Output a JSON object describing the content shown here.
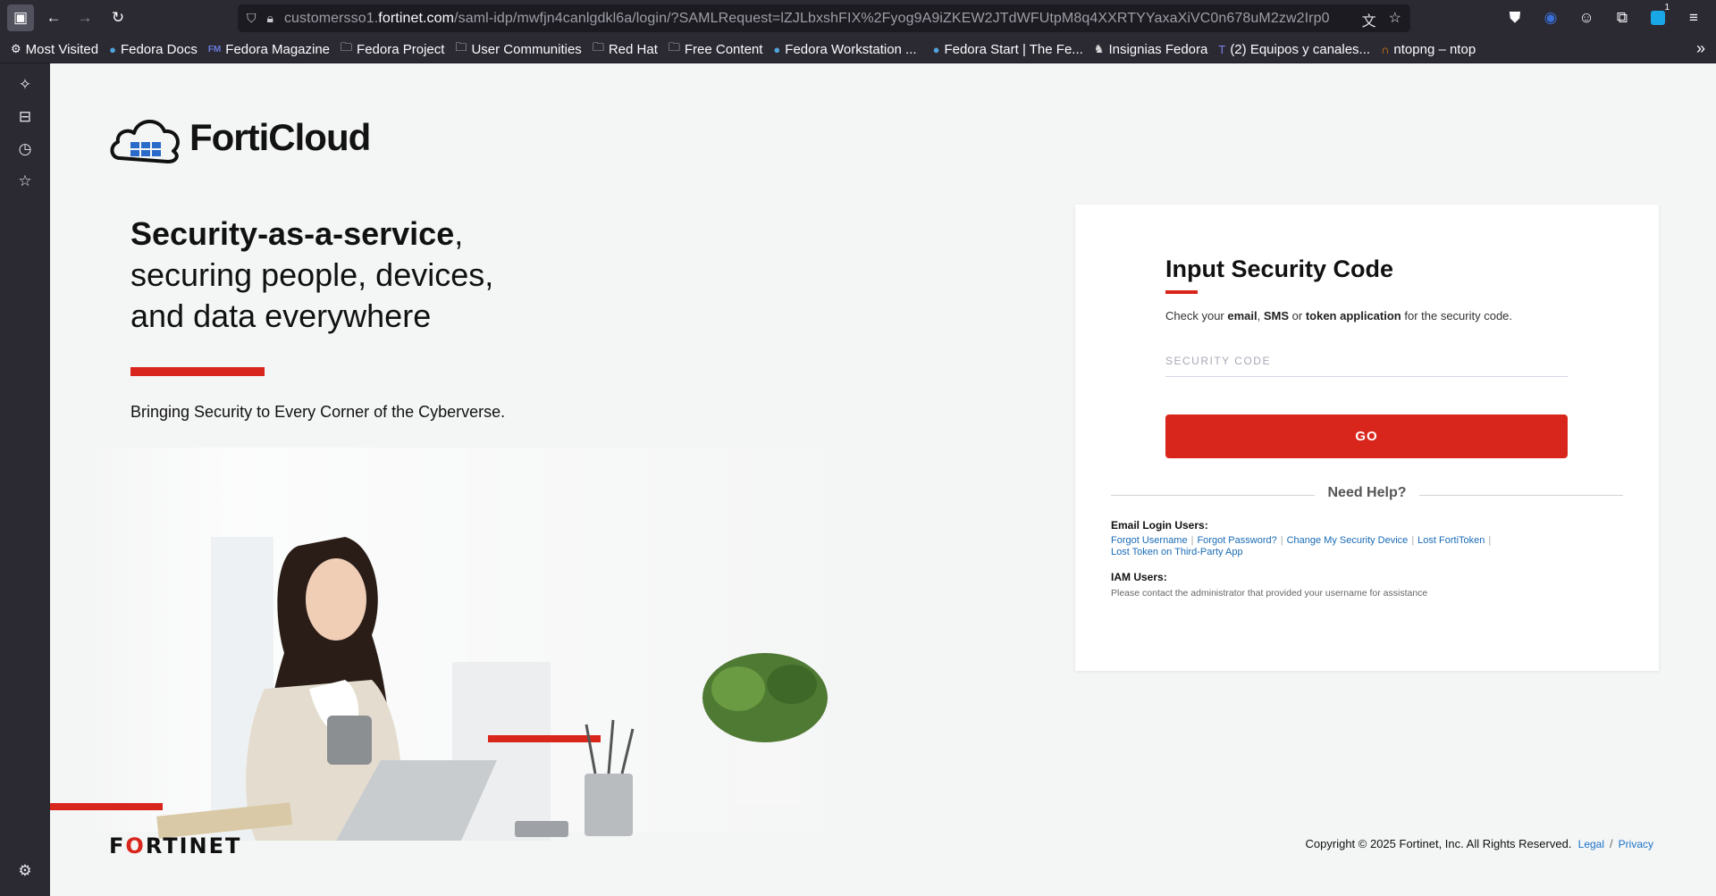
{
  "browser": {
    "url_host_prefix": "customersso1.",
    "url_host": "fortinet.com",
    "url_path": "/saml-idp/mwfjn4canlgdkl6a/login/?SAMLRequest=lZJLbxshFIX%2Fyog9A9iZKEW2JTdWFUtpM8q4XXRTYYaxaXiVC0n678uM2zw2Irp0"
  },
  "bookmarks": [
    {
      "label": "Most Visited",
      "icon": "gear"
    },
    {
      "label": "Fedora Docs",
      "icon": "fedora"
    },
    {
      "label": "Fedora Magazine",
      "icon": "fm"
    },
    {
      "label": "Fedora Project",
      "icon": "folder"
    },
    {
      "label": "User Communities",
      "icon": "folder"
    },
    {
      "label": "Red Hat",
      "icon": "folder"
    },
    {
      "label": "Free Content",
      "icon": "folder"
    },
    {
      "label": "Fedora Workstation ...",
      "icon": "fedora"
    },
    {
      "label": "Fedora Start | The Fe...",
      "icon": "fedora"
    },
    {
      "label": "Insignias Fedora",
      "icon": "badge"
    },
    {
      "label": "(2) Equipos y canales...",
      "icon": "teams"
    },
    {
      "label": "ntopng – ntop",
      "icon": "ntop"
    }
  ],
  "extension_badge_count": "1",
  "page": {
    "logo_text": "FortiCloud",
    "headline_bold": "Security-as-a-service",
    "headline_rest_1": ",",
    "headline_line2": "securing people, devices,",
    "headline_line3": "and data everywhere",
    "tagline": "Bringing Security to Every Corner of the Cyberverse.",
    "footer_brand": "FORTINET",
    "copyright": "Copyright © 2025 Fortinet, Inc.  All Rights Reserved.",
    "legal_link": "Legal",
    "privacy_link": "Privacy",
    "link_separator": "/"
  },
  "card": {
    "title": "Input Security Code",
    "desc_1": "Check your ",
    "desc_email": "email",
    "desc_2": ", ",
    "desc_sms": "SMS",
    "desc_3": " or ",
    "desc_token": "token application",
    "desc_4": " for the security code.",
    "code_placeholder": "SECURITY CODE",
    "code_value": "",
    "go_label": "GO",
    "help_label": "Need Help?",
    "email_users_heading": "Email Login Users:",
    "links": [
      "Forgot Username",
      "Forgot Password?",
      "Change My Security Device",
      "Lost FortiToken",
      "Lost Token on Third-Party App"
    ],
    "iam_heading": "IAM Users:",
    "iam_note": "Please contact the administrator that provided your username for assistance"
  },
  "colors": {
    "accent_red": "#d8261c",
    "link_blue": "#1a6bb5",
    "chrome_bg": "#2b2a33"
  }
}
